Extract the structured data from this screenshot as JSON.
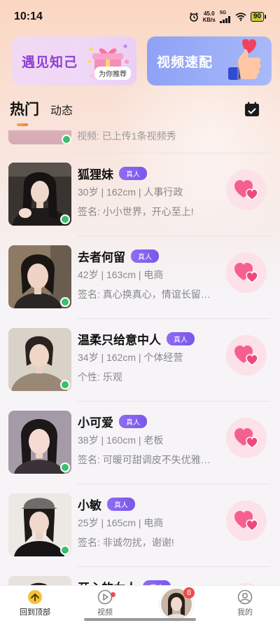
{
  "status_bar": {
    "time": "10:14",
    "net_speed_value": "45.0",
    "net_speed_unit": "KB/s",
    "network": "5G",
    "battery": "90"
  },
  "banners": {
    "left_title": "遇见知己",
    "left_tag": "为你推荐",
    "right_title": "视频速配"
  },
  "tabs": {
    "hot": "热门",
    "moments": "动态"
  },
  "partial_item_text": "视频: 已上传1条视频秀",
  "profiles": [
    {
      "name": "狐狸妹",
      "badge": "真人",
      "info": "30岁 | 162cm | 人事行政",
      "sign": "签名: 小小世界，开心至上!"
    },
    {
      "name": "去者何留",
      "badge": "真人",
      "info": "42岁 | 163cm | 电商",
      "sign": "签名: 真心换真心，情谊长留…"
    },
    {
      "name": "温柔只给意中人",
      "badge": "真人",
      "info": "34岁 | 162cm | 个体经营",
      "sign": "个性: 乐观"
    },
    {
      "name": "小可爱",
      "badge": "真人",
      "info": "38岁 | 160cm | 老板",
      "sign": "签名: 可暖可甜调皮不失优雅…"
    },
    {
      "name": "小敏",
      "badge": "真人",
      "info": "25岁 | 165cm | 电商",
      "sign": "签名: 非诚勿扰，谢谢!"
    },
    {
      "name": "开心的女人",
      "badge": "真人",
      "info": "",
      "sign": ""
    }
  ],
  "nav": {
    "home_label": "回到顶部",
    "video_label": "视频",
    "center_badge": "8",
    "me_label": "我的"
  },
  "colors": {
    "verified_badge": "#7b57ea",
    "online": "#39c06a",
    "like_bg": "#fde1e8",
    "like_heart": "#f0487a",
    "tab_underline": "#f6a844",
    "nav_badge": "#f04b4b"
  }
}
